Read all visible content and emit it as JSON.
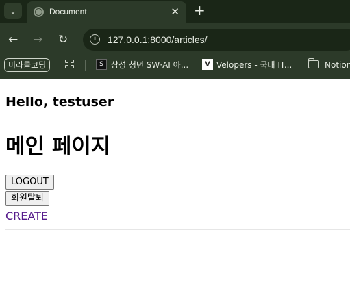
{
  "browser": {
    "tab_title": "Document",
    "tab_close": "✕",
    "new_tab": "+",
    "search_tabs": "⌄",
    "back": "←",
    "forward": "→",
    "reload": "↻",
    "url": "127.0.0.1:8000/articles/"
  },
  "bookmarks": {
    "pill_label": "미라클코딩",
    "items": [
      {
        "label": "삼성 청년 SW·AI 아...",
        "icon": "ssafy-favicon",
        "glyph": "S"
      },
      {
        "label": "Velopers - 국내 IT...",
        "icon": "velopers-favicon",
        "glyph": "V"
      },
      {
        "label": "Notion",
        "icon": "folder-icon"
      }
    ]
  },
  "page": {
    "greeting": "Hello, testuser",
    "heading": "메인 페이지",
    "logout_label": "LOGOUT",
    "withdraw_label": "회원탈퇴",
    "create_label": "CREATE"
  }
}
